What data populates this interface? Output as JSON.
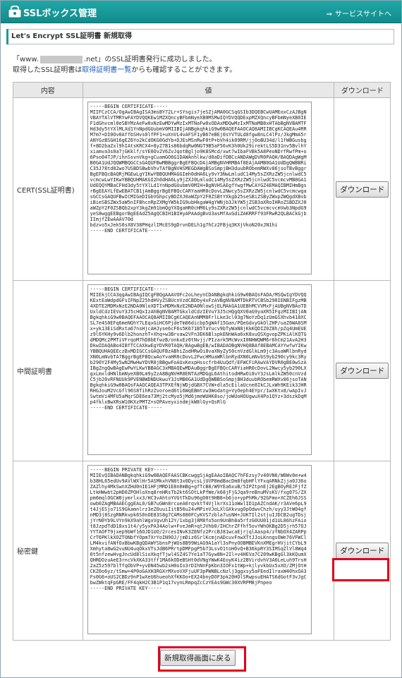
{
  "header": {
    "title": "SSLボックス管理",
    "top_link": "サービスサイトへ",
    "top_link_arrow": "⇒"
  },
  "subheader": "Let's Encrypt SSL証明書 新規取得",
  "message": {
    "line1_prefix": "「www.",
    "line1_suffix": ".net」のSSL証明書発行に成功しました。",
    "line2_prefix": "取得したSSL証明書は",
    "line2_link": "取得証明書一覧",
    "line2_suffix": "からも確認することができます。"
  },
  "table": {
    "headers": [
      "内容",
      "値",
      "ダウンロード"
    ],
    "rows": [
      {
        "label": "CERT(SSL証明書)",
        "value": "-----BEGIN CERTIFICATE-----\nMIIFCzCCA/OgAwIBAgISA3msBY72Lr+SYsgis7jeSZjAMA0GCSqGSIb3DQEBCwUAMEoxCzAJBgNVBAYTAlVTMRYwFAYDVQQKEw1MZXQncyBFbmNyeXB0MSMwIQYDVQQDExpMZXQncyBFbmNyeXB0IEF1dGhvcml0eSBYMzAeFw0xNzEwMDYwMzIxMTNaFw0xODAxMDQwMzIxMTNaMB8xHTAbBgNVBAMTFHd3dy5tYXlMLXd1YnNpdGUubmV0MIIBIjANBgkqhkiG9w0BAQEFAAOCAQ8AMIIBCgKCAQEAu4RRM7m7+DI0Ov0AffbSHvs0lfPF1+uXnVL4vAFSF1yB67eBEj0sYVTULd8fgw8nLC4lPz/JkgMmA5rANYGzBSGH16gEZ6Yo2kCdOKG0GdYb+DJEsMSnRwF0tP+bVh4ik09RM/jj0oBU34d/l1fWBGusbgf+8D2baZxl9hIAtsKRCX4+8yZ7B1s86bdqRw0NGT9B5aF56vK3h0Uk29irektLS5D31nv5BvlhYxiamva3s0a7jGKklf/sYE0Ov2V6ZvJqotBgljo9K8SMcd/xwt7wIbaFVBk5A8PeoNDrfRwfPm+o6Pso04TJP/ihnSsvnVkg+gCuamGO6G1DAWAnhlkw/d0aDifDBCcANDAWgDVR0PAQH/BAQDAgWgMB0GA1UdJQQWMBQGCCsGAQUFBwMBBggrBgEFBQcDAjAMBgNVHRMBAf8EAjAAMB0GA1UdDgQWBBRiC35J78td02wo7USBDSBwbVhvTAfBgNVHSMEGDAWgBSoSmpjBH3duubRObemRWXv86jsoTBvBggrBgEFBQcBAQRjMGEwLgYIKwYBBQUHMAGGImh0dHA6Ly9vY3NwLmludC14My5sZXRzZW5jcnlwdC5vcmcwLwYIKwYBBQUHMAKGI2h0dHA6Ly9jZXJ0LmludC14My5sZXRzZW5jcnlwdC5vcmcvMB8GA1UdEQQYMBaCFHd3dy5tYXlLd1YnNpdGUubmV0MIH+BgNVHSAEgfYwgfMwCAYGZ4EMAQIBMIHmBgsrBgEEAYLfEwEBATCB1jAmBggrBgEFBQcCARYaaHR0cDovL2Nwcy5sZXRzZW5jcnlwdC5vcmcwgasGCCsGAQUFBwICMIGeDIGbVGhpcyBDZXJ0aWZpY2F0ZSBtYXkgb25seSBiZSByZWxpZWQgdXBvbiBieSBSZWx5aW5nIFBhcnRpZXMgYW5kIG9ubHkgaW4gYWNjb3JkYW5jZSB3aXRoIHRoZSBDZXJ0aWZpY2F0ZSBQb2xpY3kgZm91bmQgYXQgaHR0cHM6Ly9sZXRzZW5jcnlwdC5vcmcvcmVwb3NpdG9yeS8wggEEBgorBgEEAdZ5AgQCBIH1BIHyAPAAdgBvU3asMfAxGdiZAKRRFf93FRwR2QLBACkGjbIImjfZEwAAAV70d\nbdzvo5xJekS0sX8V38PHqzlIMcES9gDrvnDELh1g7hCz2FBjq3KXjVkoN20xJN1hi\n-----END CERTIFICATE-----",
        "button": "ダウンロード"
      },
      {
        "label": "中間証明書",
        "value": "-----BEGIN CERTIFICATE-----\nMIIEkjCCA3qgAwIBAgIQCgFBQgAAAVOFc2oLheynCDANBgkqhkiG9w0BAQsFADA/MSQwIgYDVQQKExtEaWdpdGFsIFNpZ25hdHVyZSBUcnVzdCBDby4xFzAVBgNVBAMTDkRTVCBSb290IENBIFgzMB4XDTE2MDMxNzE2NDA0NloXDTIxMDMxNzE2NDA0NlowSjELMAkGA1UEBhMCVVMxFjAUBgNVBAoTDUxldCdzIEVuY3J5cHQxIzAhBgNVBAMTGkxldCdzIEVuY3J5cHQgQXV0aG9yaXR5IFgzMIIBIjANBgkqhkiG9w0BAQEFAAOCAQ8AMIIBCgKCAQEAnNMM8FrlLke3cl03g7NoYzDq1zUmGSXhvb418XCSL7e4S0EFq6meNQhY7LEqxGiHC6PjdeTm86dicbp5gWAf15Gan/PQeGdxyGkOlZHP/uaZ6WA8SMx+yk13EiSdRxta67nsHjcAHJyse6cF6s5K671B5TaYucv9bTyWaN8jKkKQDIZ0Z8h/pZq4UmEUEz9l6YKHy9v6Dlb2honzhT+Xhq+w3Brvaw2VFn3EK6BlspkENnWAa6xK8xuQSXgvopZPKiAlKQTGdMDQMc2PMTiVFrqoM7hD8bEfwzB/onkxEz0tNvjj/PIzark5McWvxI0NHWQWM6r6hCm21AvA2H3DkwIDAQABo4IBfTCCAXkwEgYDVR0TAQH/BAgwBgEB/wIBADAOBgNVHQ8BAf8EBAMCAYYwfwYIKwYBBQUHAQEEczBxMDIGCCsGAQUFBzABhiZodHRwOi8vaXNyZy50cnVzdGlkLm9jc3AuaWRlbnRydXN0LmNvbTA7BggrBgEFBQcwAoYvaHR0cDovL2FwcHMuaWRlbnRydXN0LmNvbS9yb290cy9kc3Ryb290Y2F4My5wN2MwHwYDVR0jBBgwFoAUxKexpHsscfrb4UuQdf/EFWCFiRAwVAYDVR0gBE0wSzAIBgZngQwBAgEwPwYLKwYBBAGC3xMBAQEwMDAuBggrBgEFBQcCARYiaHR0cDovL2Nwcy5yb290LXgxLmxldHNlbmNyeXB0Lm9yZzA8BgNVHR8ENTAzMDGgL6AthitodHRwOi8vY3JsLmlkZW50cnVzdC5jb20vRFNUUk9PVENBWDNDUkwuY3JsMB0GA1UdDgQWBBSoSmpjBH3duubRObemRWXv86jsoTANBgkqhkiG9w0BAQsFAAOCAQEA3TPXEfNjWDjdGBX7CVW+dla5cEilaUcne8IkCJLxWh9KEik3JHRRHGJouM2VcGfl96S8TihRzZvoroed6ti6WqEBmtzw3Wodatg+VyOeph4EYpr/1wXKtx8/wApIvJSwtmVi4MFU5aMqrSDE6ea73Mj2tcMyo5jMd6jmeWUHK8so/joWUoHOUgwuX4Po1QYz+3dszkDqMp4fklxBwXRsW10KXzPMTZ+sOPAveyxindmjkW8lGy+QsRlG\n-----END CERTIFICATE-----",
        "button": "ダウンロード"
      },
      {
        "label": "秘密鍵",
        "value": "-----BEGIN PRIVATE KEY-----\nMIIEvQIBADANBgkqhkiG9w0BAQEFAASCBKcwggSjAgEAAoIBAQC7hFEzsy7v40VN6/W8Wv0e+w4b38HL65edUv9AVlWXlHr5ASMkxhVN8t3x0DycsLjUVP8mdBacDm8fqbHFlYFxqARNkZjja0J36oZAZlhy4MkSwnXZHd0nIE1HFjMRD1E8n0mBg+gfTcB8/W9YEa6xuB/5IPZtpnEj2EgBOyREJFjfZLtkHWwbt2pHD0ZPOHloXnq8reHRsTb2kt6SOtLkPfWe/k68jFjGJqa9reBnuMVsKV/fxg07S/ZXpm6mqlOGCW0jymrlxx3/HC3vAhtoYVGtTkDu96gO0t9HB8+b6jo+ypPhMk/92GFmo+XCZEh6JSSowb0ZAgMBAAECggEAL0/GB7uGWn8rcueA0rqvktT4VjlkrXs11oWwlID1pAZCndAK/r3AVe6pL9t4JjESjo71S9Gkamnlrz3eZ0uuiIitB56u24vMPinVJoLXlGXkvugOpOdwvChzh/uyy3JtW04gfnMD3j8SzgRNRkvpk6S0nOE83S8g7CAMs080FCyKVS7zbla7usNH+JUKTIl2stjuIJDCB2ugTDsjjYrN0Yb9LVYn9kX9ahlWgxVgvUh12Y/1xbg3j8M8fo5on9UnBh8a5rfzG0UU01jd1UL86hzFAiot8JzpdTdD18xs1t4/y5yxPA34Aolw+FveJmR+qtJVhb0/IHChrZFfhf5ovYWhOKBg2D5jrh57OJYYTAOFT9jxep9bWf16OJD1UO/2rcesINvK3ZENfz2PrcBJ81wcaEjrjqlAasp4/zfNbOX4ZARPpCrT6PKlkXOZTONbfYOpm7XrYoIN9OJ/jmDiz6SrlKcmjnADcuvFnwXTtJJoLKnngsOWe76VFWClLM4kvifANfOxBbwKBgQDAWYSbnsPjWUs8B99WiAG9A1aYl3sPnyOOBMBEVKnXMEgrHVjitCYbL9Xmhyta8wG2vuNU4uqOkxVTsJdB6PRrtpDMFpgP5b73LsvO1toHOvQ+B36kpRY3SIMSqZlVl8Wq40t5nfzewHvgJncUd8lSioXkqfTjwl4SZ4S7Ye1aT7Gyw8N+2Il+v4HEVa7C209wKBgGl3kKQumXQHRDOzuAeE3rncVkXKA33tff1MA6kODeBSHt0dVNgYWwK4EoyK4iz2BVirdvhV3A6LeLuh9TrsH2aZ5z597blTfqObVP+yvDN45wb2sH0oIo3rDIhNnFpKbn3IOFx1tWp+kjlyvkbUx5xXO/ZMjOtHCKZ0o6yz/tSmw+4P0oGAXH3RGXrMXvoVXFjuUF3pPWNBLcNzlj3ggxsy5aFEedIlraxW40hxOA3Fs0G6+oUS2CBDz9nP1wXeU6hueohXfKKOo+EX24bnyDOF3pk20HOlSRwpsuEHATS6dGotF3vJgCbwZWktqFpGRE/FF4qkH2C3B1P1q17vynLRmpqZcCzYEAs9GWc30XVRPM8jPnpeo\n-----END PRIVATE KEY-----",
        "button": "ダウンロード"
      }
    ]
  },
  "back_button": "新規取得画面に戻る",
  "colors": {
    "header": "#1a9e9c",
    "highlight": "#e0001a",
    "link": "#1a5fb4"
  }
}
